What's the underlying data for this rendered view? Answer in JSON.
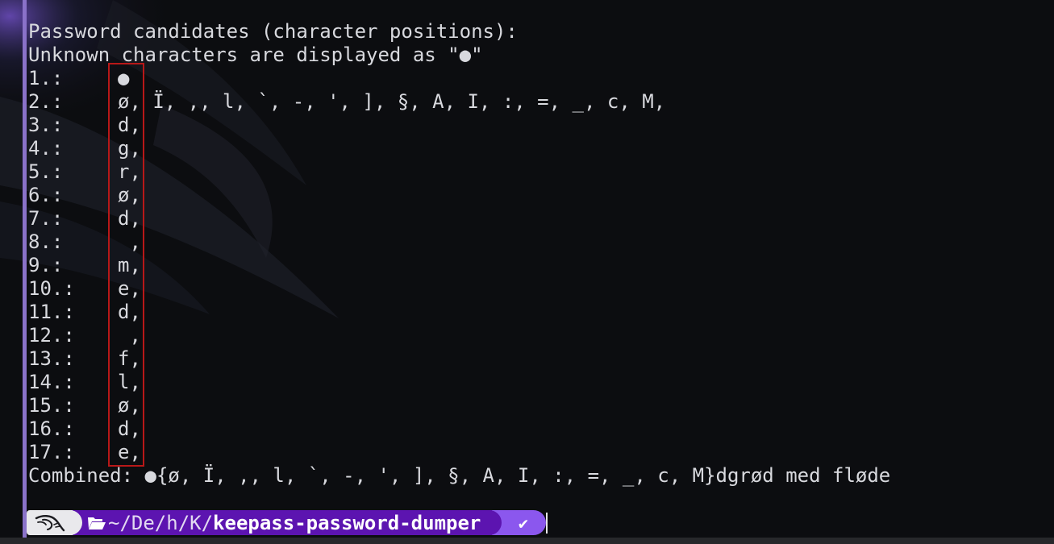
{
  "terminal": {
    "heading": "Password candidates (character positions):",
    "unknown_note": "Unknown characters are displayed as \"●\"",
    "rows": [
      {
        "index": "1.:",
        "chars": "●"
      },
      {
        "index": "2.:",
        "chars": "ø, Ï, ,, l, `, -, ', ], §, A, I, :, =, _, c, M,"
      },
      {
        "index": "3.:",
        "chars": "d,"
      },
      {
        "index": "4.:",
        "chars": "g,"
      },
      {
        "index": "5.:",
        "chars": "r,"
      },
      {
        "index": "6.:",
        "chars": "ø,"
      },
      {
        "index": "7.:",
        "chars": "d,"
      },
      {
        "index": "8.:",
        "chars": " ,"
      },
      {
        "index": "9.:",
        "chars": "m,"
      },
      {
        "index": "10.:",
        "chars": "e,"
      },
      {
        "index": "11.:",
        "chars": "d,"
      },
      {
        "index": "12.:",
        "chars": " ,"
      },
      {
        "index": "13.:",
        "chars": "f,"
      },
      {
        "index": "14.:",
        "chars": "l,"
      },
      {
        "index": "15.:",
        "chars": "ø,"
      },
      {
        "index": "16.:",
        "chars": "d,"
      },
      {
        "index": "17.:",
        "chars": "e,"
      }
    ],
    "combined": "Combined: ●{ø, Ï, ,, l, `, -, ', ], §, A, I, :, =, _, c, M}dgrød med fløde"
  },
  "prompt": {
    "os_icon": "kali-dragon-icon",
    "folder_icon": "folder-open-icon",
    "path_prefix": "~/De/h/K/",
    "path_current": "keepass-password-dumper",
    "status": "✔"
  },
  "colors": {
    "background": "#0c0d10",
    "text": "#d8d9de",
    "highlight_border": "#b81818",
    "prompt_os_bg": "#e9e9ec",
    "prompt_path_bg": "#5c14b0",
    "prompt_status_bg": "#8b57ee",
    "left_accent": "#8a72c9"
  }
}
